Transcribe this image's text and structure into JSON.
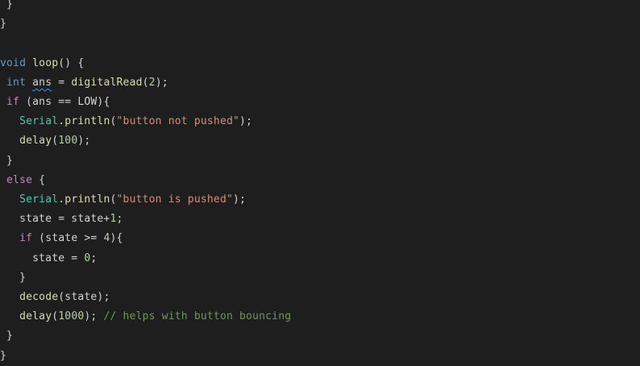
{
  "editor": {
    "colors": {
      "background": "#1e1e1e",
      "keyword": "#569cd6",
      "control_keyword": "#c586c0",
      "function": "#dcdcaa",
      "class": "#4ec9b0",
      "string": "#ce9178",
      "number": "#b5cea8",
      "comment": "#6a9955",
      "plain": "#d4d4d4",
      "squiggle": "#3794ff"
    },
    "lines": [
      [
        {
          "t": " }",
          "c": "plain"
        }
      ],
      [
        {
          "t": "}",
          "c": "plain"
        }
      ],
      [],
      [
        {
          "t": "void",
          "c": "kw"
        },
        {
          "t": " ",
          "c": "plain"
        },
        {
          "t": "loop",
          "c": "fn"
        },
        {
          "t": "() {",
          "c": "plain"
        }
      ],
      [
        {
          "t": " ",
          "c": "plain"
        },
        {
          "t": "int",
          "c": "kw"
        },
        {
          "t": " ",
          "c": "plain"
        },
        {
          "t": "ans",
          "c": "plain",
          "squiggle": true
        },
        {
          "t": " = ",
          "c": "plain"
        },
        {
          "t": "digitalRead",
          "c": "fn"
        },
        {
          "t": "(",
          "c": "plain"
        },
        {
          "t": "2",
          "c": "num"
        },
        {
          "t": ");",
          "c": "plain"
        }
      ],
      [
        {
          "t": " ",
          "c": "plain"
        },
        {
          "t": "if",
          "c": "kw2"
        },
        {
          "t": " (ans == LOW){",
          "c": "plain"
        }
      ],
      [
        {
          "t": "   ",
          "c": "plain"
        },
        {
          "t": "Serial",
          "c": "cls"
        },
        {
          "t": ".",
          "c": "plain"
        },
        {
          "t": "println",
          "c": "fn"
        },
        {
          "t": "(",
          "c": "plain"
        },
        {
          "t": "\"button not pushed\"",
          "c": "str"
        },
        {
          "t": ");",
          "c": "plain"
        }
      ],
      [
        {
          "t": "   ",
          "c": "plain"
        },
        {
          "t": "delay",
          "c": "fn"
        },
        {
          "t": "(",
          "c": "plain"
        },
        {
          "t": "100",
          "c": "num"
        },
        {
          "t": ");",
          "c": "plain"
        }
      ],
      [
        {
          "t": " }",
          "c": "plain"
        }
      ],
      [
        {
          "t": " ",
          "c": "plain"
        },
        {
          "t": "else",
          "c": "kw2"
        },
        {
          "t": " {",
          "c": "plain"
        }
      ],
      [
        {
          "t": "   ",
          "c": "plain"
        },
        {
          "t": "Serial",
          "c": "cls"
        },
        {
          "t": ".",
          "c": "plain"
        },
        {
          "t": "println",
          "c": "fn"
        },
        {
          "t": "(",
          "c": "plain"
        },
        {
          "t": "\"button is pushed\"",
          "c": "str"
        },
        {
          "t": ");",
          "c": "plain"
        }
      ],
      [
        {
          "t": "   state = state+",
          "c": "plain"
        },
        {
          "t": "1",
          "c": "num"
        },
        {
          "t": ";",
          "c": "plain"
        }
      ],
      [
        {
          "t": "   ",
          "c": "plain"
        },
        {
          "t": "if",
          "c": "kw2"
        },
        {
          "t": " (state >= ",
          "c": "plain"
        },
        {
          "t": "4",
          "c": "num"
        },
        {
          "t": "){",
          "c": "plain"
        }
      ],
      [
        {
          "t": "     state = ",
          "c": "plain"
        },
        {
          "t": "0",
          "c": "num"
        },
        {
          "t": ";",
          "c": "plain"
        }
      ],
      [
        {
          "t": "   }",
          "c": "plain"
        }
      ],
      [
        {
          "t": "   ",
          "c": "plain"
        },
        {
          "t": "decode",
          "c": "fn"
        },
        {
          "t": "(state);",
          "c": "plain"
        }
      ],
      [
        {
          "t": "   ",
          "c": "plain"
        },
        {
          "t": "delay",
          "c": "fn"
        },
        {
          "t": "(",
          "c": "plain"
        },
        {
          "t": "1000",
          "c": "num"
        },
        {
          "t": "); ",
          "c": "plain"
        },
        {
          "t": "// helps with button bouncing",
          "c": "cmt"
        }
      ],
      [
        {
          "t": " }",
          "c": "plain"
        }
      ],
      [
        {
          "t": "}",
          "c": "plain"
        }
      ]
    ]
  }
}
